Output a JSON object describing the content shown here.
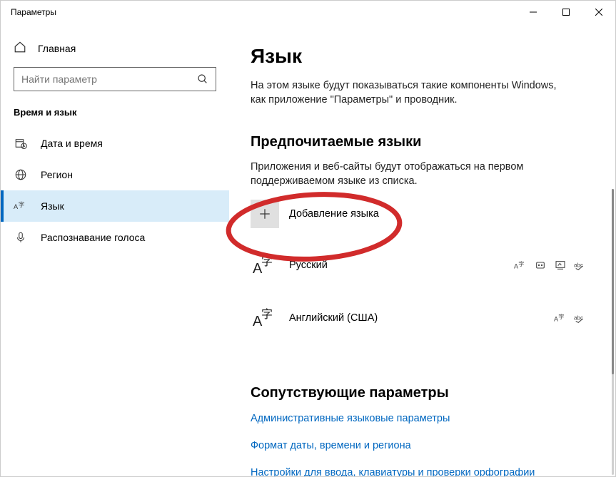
{
  "window": {
    "title": "Параметры"
  },
  "sidebar": {
    "home": "Главная",
    "search_placeholder": "Найти параметр",
    "section": "Время и язык",
    "items": [
      {
        "label": "Дата и время"
      },
      {
        "label": "Регион"
      },
      {
        "label": "Язык"
      },
      {
        "label": "Распознавание голоса"
      }
    ]
  },
  "main": {
    "title": "Язык",
    "description": "На этом языке будут показываться такие компоненты Windows, как приложение \"Параметры\" и проводник.",
    "preferred": {
      "title": "Предпочитаемые языки",
      "description": "Приложения и веб-сайты будут отображаться на первом поддерживаемом языке из списка.",
      "add_label": "Добавление языка",
      "languages": [
        {
          "name": "Русский",
          "indicators": [
            "display-lang",
            "tts",
            "handwriting",
            "spellcheck"
          ]
        },
        {
          "name": "Английский (США)",
          "indicators": [
            "display-lang",
            "spellcheck"
          ]
        }
      ]
    },
    "related": {
      "title": "Сопутствующие параметры",
      "links": [
        "Административные языковые параметры",
        "Формат даты, времени и региона",
        "Настройки для ввода, клавиатуры и проверки орфографии"
      ]
    }
  }
}
